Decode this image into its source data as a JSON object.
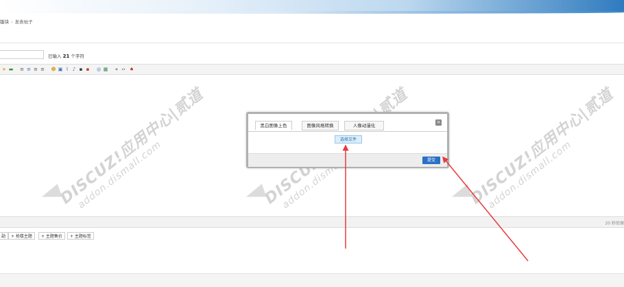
{
  "breadcrumb": {
    "forum": "版块",
    "sep": "›",
    "current": "发表帖子"
  },
  "subject": {
    "value": "",
    "count_prefix": "已输入",
    "count": "21",
    "count_suffix": "个字符"
  },
  "toolbar": {
    "icons": [
      {
        "name": "bold-icon",
        "glyph": "➤",
        "color": "#e0a52a"
      },
      {
        "name": "color-icon",
        "glyph": "▬",
        "color": "#3b8f3b"
      },
      {
        "name": "align-left-icon",
        "glyph": "≡",
        "color": "#555"
      },
      {
        "name": "align-center-icon",
        "glyph": "≡",
        "color": "#3a6fb0"
      },
      {
        "name": "align-right-icon",
        "glyph": "≡",
        "color": "#555"
      },
      {
        "name": "align-justify-icon",
        "glyph": "≡",
        "color": "#555"
      },
      {
        "name": "smiley-icon",
        "glyph": "☻",
        "color": "#e0a52a"
      },
      {
        "name": "image-icon",
        "glyph": "▣",
        "color": "#3a6fb0"
      },
      {
        "name": "attachment-icon",
        "glyph": "⌇",
        "color": "#555"
      },
      {
        "name": "music-icon",
        "glyph": "♪",
        "color": "#3a6fb0"
      },
      {
        "name": "video-icon",
        "glyph": "▪",
        "color": "#333"
      },
      {
        "name": "flash-icon",
        "glyph": "▪",
        "color": "#c0392b"
      },
      {
        "name": "at-icon",
        "glyph": "◎",
        "color": "#3a6fb0"
      },
      {
        "name": "table-icon",
        "glyph": "▦",
        "color": "#2e8b57"
      },
      {
        "name": "quote-icon",
        "glyph": "«",
        "color": "#333"
      },
      {
        "name": "code-icon",
        "glyph": "‹›",
        "color": "#333"
      },
      {
        "name": "hide-icon",
        "glyph": "♠",
        "color": "#c0392b"
      }
    ]
  },
  "status": {
    "autosave": "20 秒后保"
  },
  "options": [
    {
      "label": "勋"
    },
    {
      "label": "+ 抢楼主题"
    },
    {
      "label": "+ 主题售价"
    },
    {
      "label": "+ 主题标签"
    }
  ],
  "watermark": {
    "line1": "DISCUZ!应用中心|贰道",
    "line2": "addon.dismall.com"
  },
  "modal": {
    "tabs": [
      {
        "label": "黑白图像上色",
        "active": true
      },
      {
        "label": "图像风格转换",
        "active": false
      },
      {
        "label": "人像动漫化",
        "active": false
      }
    ],
    "close_glyph": "×",
    "choose_file": "选择文件",
    "submit": "提交"
  },
  "colors": {
    "arrow": "#e8383a",
    "primary": "#2a70c5"
  }
}
